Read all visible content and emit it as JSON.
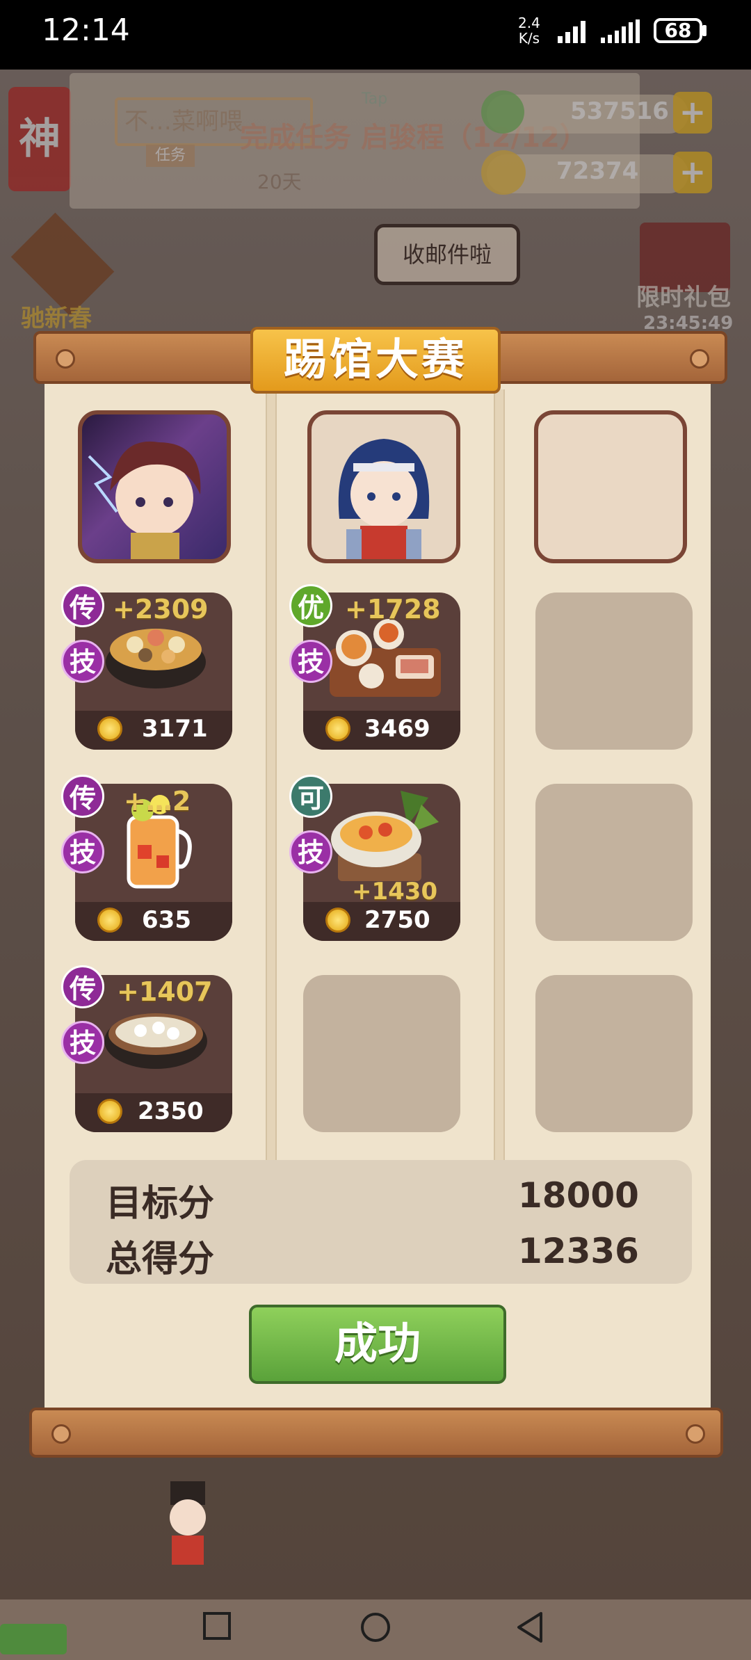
{
  "status_bar": {
    "time": "12:14",
    "net_speed_value": "2.4",
    "net_speed_unit": "K/s",
    "battery": "68"
  },
  "hud": {
    "badge": "神",
    "player_name": "不…菜啊喂",
    "task_tag": "任务",
    "task_text": "完成任务 启骏程（12/12）",
    "days": "20天",
    "tap_hint": "Tap",
    "currency_green": "537516",
    "currency_gold": "72374",
    "event_left": "驰新春",
    "event_right": "限时礼包",
    "event_timer": "23:45:49",
    "speech_bubble": "收邮件啦"
  },
  "panel": {
    "title": "踢馆大赛",
    "columns": [
      {
        "portrait": "chef-red-hair",
        "dishes": [
          {
            "rank": "传",
            "rank_color": "#8e2a96",
            "skill": "技",
            "bonus": "+2309",
            "price": "3171",
            "icon": "hotpot"
          },
          {
            "rank": "传",
            "rank_color": "#8e2a96",
            "skill": "技",
            "bonus": "+…2",
            "price": "635",
            "icon": "fruit-tea"
          },
          {
            "rank": "传",
            "rank_color": "#8e2a96",
            "skill": "技",
            "bonus": "+1407",
            "price": "2350",
            "icon": "dumpling-bowl"
          }
        ]
      },
      {
        "portrait": "chef-blue-hair",
        "dishes": [
          {
            "rank": "优",
            "rank_color": "#5fa82b",
            "skill": "技",
            "bonus": "+1728",
            "price": "3469",
            "icon": "banquet-tray"
          },
          {
            "rank": "可",
            "rank_color": "#3c7a6c",
            "skill": "技",
            "bonus": "+1430",
            "price": "2750",
            "icon": "noodle-bowl"
          },
          null
        ]
      },
      {
        "portrait": null,
        "dishes": [
          null,
          null,
          null
        ]
      }
    ],
    "target_label": "目标分",
    "target_value": "18000",
    "total_label": "总得分",
    "total_value": "12336",
    "result_button": "成功"
  },
  "colors": {
    "paper": "#efe3cc",
    "wood": "#b57344",
    "gold": "#f2b53a",
    "success_green": "#6fb548",
    "legend_rank": "#8e2a96"
  }
}
